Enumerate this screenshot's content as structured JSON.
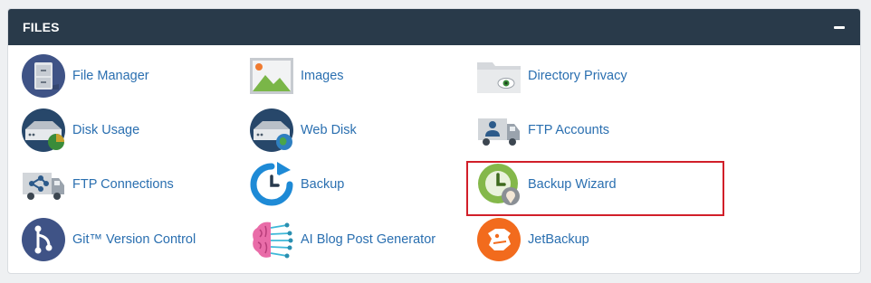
{
  "panel": {
    "title": "FILES",
    "collapse_icon": "minus-icon"
  },
  "items": {
    "file_manager": {
      "label": "File Manager",
      "icon": "file-manager-icon"
    },
    "images": {
      "label": "Images",
      "icon": "images-icon"
    },
    "directory_privacy": {
      "label": "Directory Privacy",
      "icon": "directory-privacy-icon"
    },
    "disk_usage": {
      "label": "Disk Usage",
      "icon": "disk-usage-icon"
    },
    "web_disk": {
      "label": "Web Disk",
      "icon": "web-disk-icon"
    },
    "ftp_accounts": {
      "label": "FTP Accounts",
      "icon": "ftp-accounts-icon"
    },
    "ftp_connections": {
      "label": "FTP Connections",
      "icon": "ftp-connections-icon"
    },
    "backup": {
      "label": "Backup",
      "icon": "backup-icon"
    },
    "backup_wizard": {
      "label": "Backup Wizard",
      "icon": "backup-wizard-icon",
      "highlighted": true
    },
    "git_version_control": {
      "label": "Git™ Version Control",
      "icon": "git-icon"
    },
    "ai_blog_post_generator": {
      "label": "AI Blog Post Generator",
      "icon": "ai-brain-icon"
    },
    "jetbackup": {
      "label": "JetBackup",
      "icon": "jetbackup-icon"
    }
  },
  "colors": {
    "header_bg": "#293a4a",
    "link": "#2a6fb0",
    "highlight_border": "#d11f29"
  }
}
